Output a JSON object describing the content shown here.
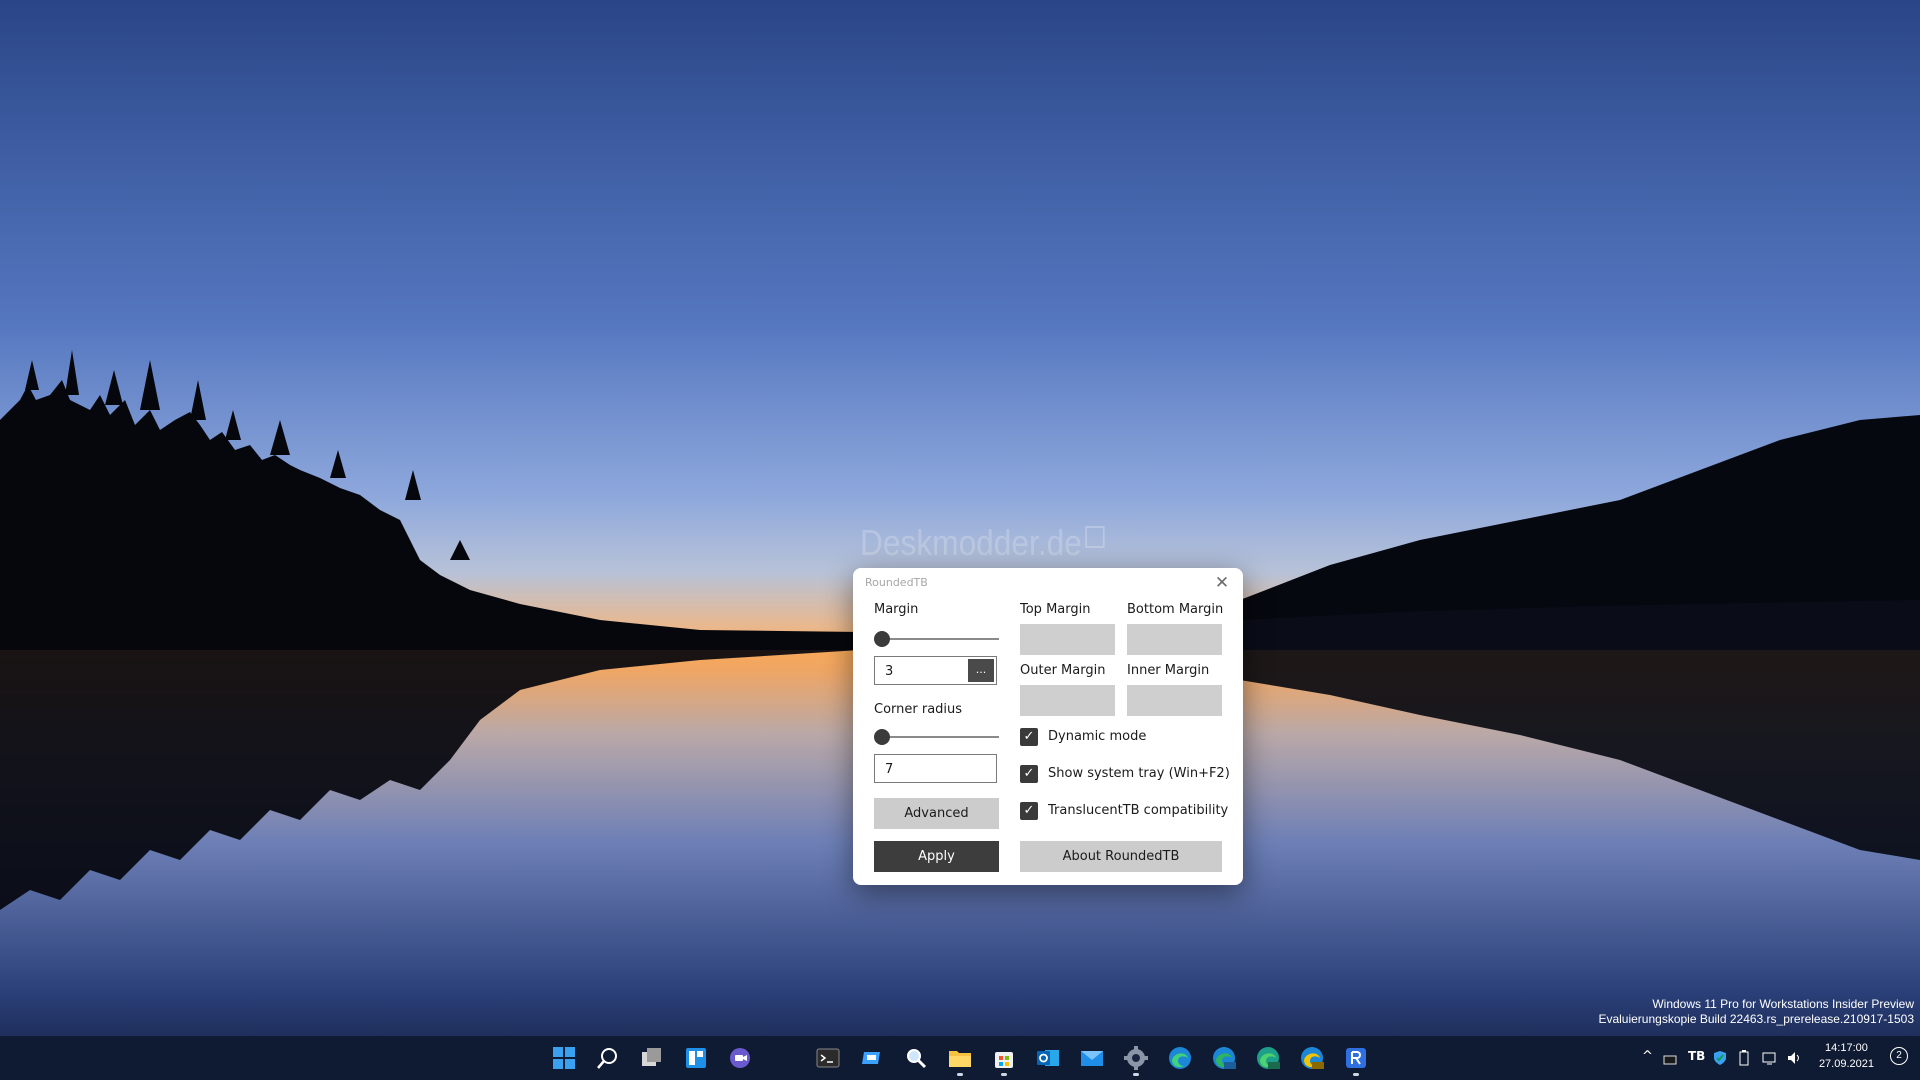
{
  "desktop": {
    "watermark": "Deskmodder.de",
    "os_line1": "Windows 11 Pro for Workstations Insider Preview",
    "os_line2": "Evaluierungskopie Build 22463.rs_prerelease.210917-1503"
  },
  "dialog": {
    "title": "RoundedTB",
    "close_glyph": "✕",
    "margin_label": "Margin",
    "margin_value": "3",
    "margin_slider_level": 0,
    "ellipsis_label": "...",
    "corner_label": "Corner radius",
    "corner_value": "7",
    "corner_slider_level": 0,
    "advanced_label": "Advanced",
    "apply_label": "Apply",
    "top_margin_label": "Top Margin",
    "bottom_margin_label": "Bottom Margin",
    "outer_margin_label": "Outer Margin",
    "inner_margin_label": "Inner Margin",
    "dynamic_mode_label": "Dynamic mode",
    "dynamic_mode_checked": true,
    "system_tray_label": "Show system tray (Win+F2)",
    "system_tray_checked": true,
    "translucent_label": "TranslucentTB compatibility",
    "translucent_checked": true,
    "about_label": "About RoundedTB",
    "check_glyph": "✓"
  },
  "taskbar": {
    "icons": [
      "windows-start-icon",
      "search-icon",
      "task-view-icon",
      "widgets-icon",
      "teams-chat-icon",
      "terminal-icon",
      "remote-desktop-icon",
      "magnifier-icon",
      "file-explorer-icon",
      "microsoft-store-icon",
      "outlook-icon",
      "mail-icon",
      "settings-icon",
      "edge-icon",
      "edge-beta-icon",
      "edge-dev-icon",
      "edge-canary-icon",
      "roundedtb-icon"
    ],
    "tray": {
      "chevron": "^",
      "tb_badge": "TB",
      "clock_time": "14:17:00",
      "clock_date": "27.09.2021",
      "notification_count": "2"
    }
  },
  "colors": {
    "sky_top": "#2a4a8e",
    "sky_mid": "#6e8fd0",
    "horizon": "#f0a060",
    "taskbar_bg": "#0f1a33",
    "accent": "#3d3d3d"
  }
}
